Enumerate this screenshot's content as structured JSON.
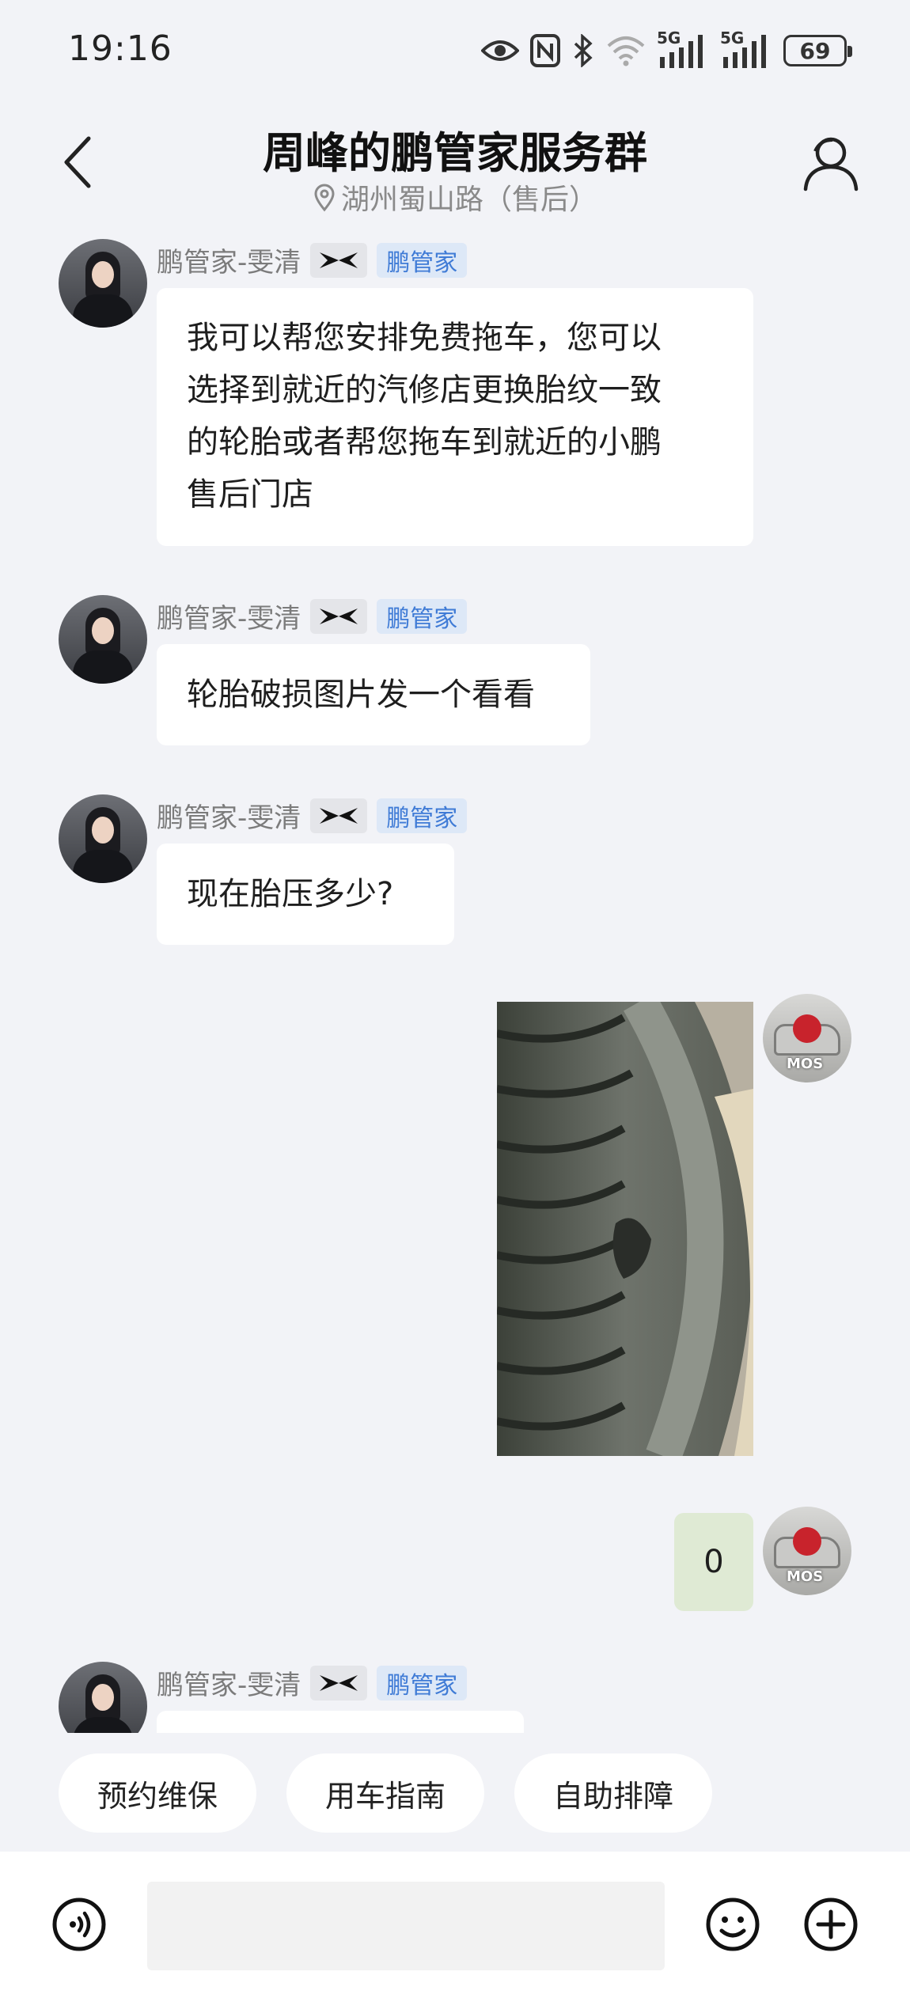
{
  "status": {
    "time": "19:16",
    "net1": "5G",
    "net2": "5G",
    "battery": "69"
  },
  "header": {
    "title": "周峰的鹏管家服务群",
    "subtitle": "湖州蜀山路（售后）"
  },
  "messages": [
    {
      "sender": "鹏管家-雯清",
      "role": "鹏管家",
      "text_lines": [
        "我可以帮您安排免费拖车，您可以",
        "选择到就近的汽修店更换胎纹一致",
        "的轮胎或者帮您拖车到就近的小鹏",
        "售后门店"
      ]
    },
    {
      "sender": "鹏管家-雯清",
      "role": "鹏管家",
      "text": "轮胎破损图片发一个看看"
    },
    {
      "sender": "鹏管家-雯清",
      "role": "鹏管家",
      "text": "现在胎压多少?"
    },
    {
      "user_text": "0"
    },
    {
      "sender": "鹏管家-雯清",
      "role": "鹏管家"
    }
  ],
  "quick_actions": [
    "预约维保",
    "用车指南",
    "自助排障"
  ],
  "input": {
    "placeholder": ""
  },
  "icons": [
    "eye-icon",
    "nfc-icon",
    "bluetooth-icon",
    "wifi-icon",
    "signal-icon",
    "back-icon",
    "location-pin-icon",
    "members-icon",
    "voice-icon",
    "emoji-icon",
    "plus-icon"
  ],
  "colors": {
    "background": "#f2f3f7",
    "user_bubble": "#dfead4",
    "role_badge_text": "#3f7bd6",
    "role_badge_bg": "#dde8f7"
  }
}
